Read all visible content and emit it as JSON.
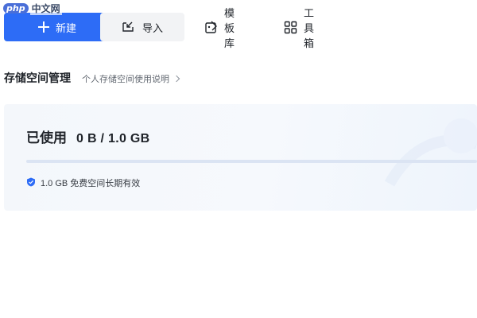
{
  "watermark": {
    "logo": "php",
    "text": "中文网"
  },
  "toolbar": {
    "new_label": "新建",
    "import_label": "导入",
    "template_label": "模板库",
    "toolbox_label": "工具箱"
  },
  "section": {
    "title": "存储空间管理",
    "help_link": "个人存储空间使用说明"
  },
  "storage": {
    "used_label": "已使用",
    "usage_text": "0 B / 1.0 GB",
    "used_fraction": 0,
    "note": "1.0 GB 免费空间长期有效"
  },
  "colors": {
    "accent": "#2d6cf6",
    "card_bg": "#f4f7fb"
  },
  "icons": [
    "plus-icon",
    "import-icon",
    "template-icon",
    "toolbox-icon",
    "chevron-right-icon",
    "shield-check-icon"
  ]
}
